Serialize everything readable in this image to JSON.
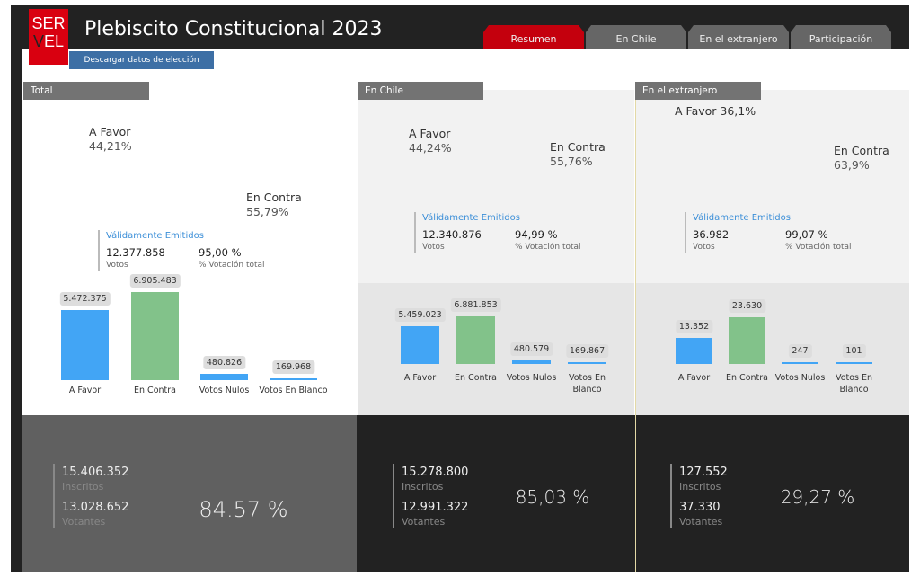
{
  "header": {
    "logo_top": "SER",
    "logo_bottom": "VEL",
    "title": "Plebiscito Constitucional 2023",
    "download_label": "Descargar datos de elección"
  },
  "tabs": [
    {
      "label": "Resumen",
      "active": true
    },
    {
      "label": "En Chile"
    },
    {
      "label": "En el extranjero"
    },
    {
      "label": "Participación"
    }
  ],
  "colors": {
    "favor": "#42a5f5",
    "contra": "#82c28a",
    "gauge": "#d9000d",
    "gauge_rest": "#f0f0f0",
    "header": "#222222",
    "active_tab": "#c4000d"
  },
  "panels": [
    {
      "title": "Total",
      "favor_label": "A Favor",
      "favor_pct": "44,21%",
      "favor_value": 44.21,
      "contra_label": "En Contra",
      "contra_pct": "55,79%",
      "valid_title": "Válidamente Emitidos",
      "votes": "12.377.858",
      "votes_label": "Votos",
      "pct_total": "95,00 %",
      "pct_total_label": "% Votación total",
      "bars": [
        {
          "label": "A Favor",
          "text": "5.472.375",
          "value": 5472375
        },
        {
          "label": "En Contra",
          "text": "6.905.483",
          "value": 6905483
        },
        {
          "label": "Votos Nulos",
          "text": "480.826",
          "value": 480826
        },
        {
          "label": "Votos En Blanco",
          "text": "169.968",
          "value": 169968
        }
      ],
      "inscritos": "15.406.352",
      "inscritos_label": "Inscritos",
      "votantes": "13.028.652",
      "votantes_label": "Votantes",
      "participation": "84.57 %",
      "participation_value": 84.57
    },
    {
      "title": "En Chile",
      "favor_label": "A Favor",
      "favor_pct": "44,24%",
      "favor_value": 44.24,
      "contra_label": "En Contra",
      "contra_pct": "55,76%",
      "valid_title": "Válidamente Emitidos",
      "votes": "12.340.876",
      "votes_label": "Votos",
      "pct_total": "94,99 %",
      "pct_total_label": "% Votación total",
      "bars": [
        {
          "label": "A Favor",
          "text": "5.459.023",
          "value": 5459023
        },
        {
          "label": "En Contra",
          "text": "6.881.853",
          "value": 6881853
        },
        {
          "label": "Votos Nulos",
          "text": "480.579",
          "value": 480579
        },
        {
          "label": "Votos En Blanco",
          "text": "169.867",
          "value": 169867
        }
      ],
      "inscritos": "15.278.800",
      "inscritos_label": "Inscritos",
      "votantes": "12.991.322",
      "votantes_label": "Votantes",
      "participation": "85,03 %",
      "participation_value": 85.03
    },
    {
      "title": "En el extranjero",
      "favor_label": "A Favor",
      "favor_pct": "36,1%",
      "favor_value": 36.1,
      "contra_label": "En Contra",
      "contra_pct": "63,9%",
      "valid_title": "Válidamente Emitidos",
      "votes": "36.982",
      "votes_label": "Votos",
      "pct_total": "99,07 %",
      "pct_total_label": "% Votación total",
      "bars": [
        {
          "label": "A Favor",
          "text": "13.352",
          "value": 13352
        },
        {
          "label": "En Contra",
          "text": "23.630",
          "value": 23630
        },
        {
          "label": "Votos Nulos",
          "text": "247",
          "value": 247
        },
        {
          "label": "Votos En Blanco",
          "text": "101",
          "value": 101
        }
      ],
      "inscritos": "127.552",
      "inscritos_label": "Inscritos",
      "votantes": "37.330",
      "votantes_label": "Votantes",
      "participation": "29,27 %",
      "participation_value": 29.27
    }
  ]
}
